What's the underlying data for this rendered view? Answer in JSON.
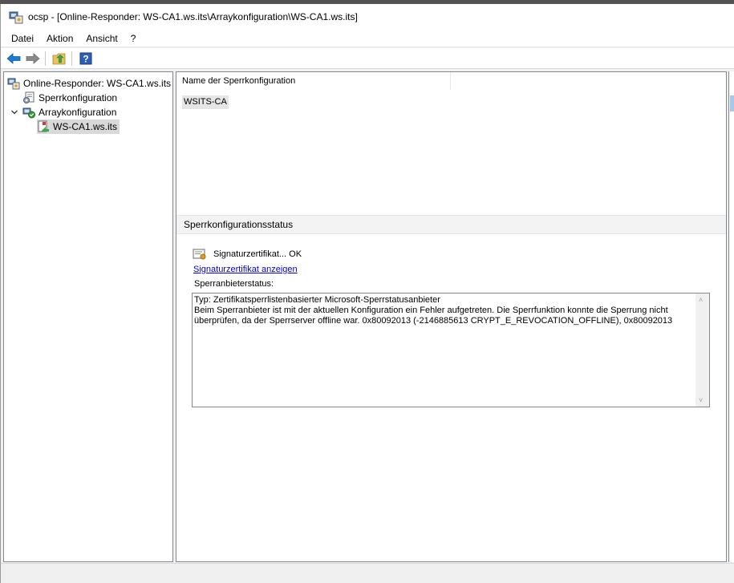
{
  "window": {
    "title": "ocsp - [Online-Responder: WS-CA1.ws.its\\Arraykonfiguration\\WS-CA1.ws.its]"
  },
  "menu": {
    "items": [
      "Datei",
      "Aktion",
      "Ansicht",
      "?"
    ]
  },
  "toolbar": {
    "buttons": [
      "back-arrow-icon",
      "forward-arrow-icon",
      "up-folder-icon",
      "help-icon"
    ]
  },
  "tree": {
    "root": "Online-Responder: WS-CA1.ws.its",
    "items": [
      {
        "label": "Sperrkonfiguration"
      },
      {
        "label": "Arraykonfiguration"
      },
      {
        "label": "WS-CA1.ws.its"
      }
    ]
  },
  "list": {
    "column_header": "Name der Sperrkonfiguration",
    "rows": [
      "WSITS-CA"
    ]
  },
  "status": {
    "section_title": "Sperrkonfigurationsstatus",
    "cert_status": "Signaturzertifikat... OK",
    "cert_link": "Signaturzertifikat anzeigen",
    "provider_label": "Sperranbieterstatus:",
    "provider_text": "Typ: Zertifikatsperrlistenbasierter Microsoft-Sperrstatusanbieter\nBeim Sperranbieter ist mit der aktuellen Konfiguration ein Fehler aufgetreten. Die Sperrfunktion konnte die Sperrung nicht überprüfen, da der Sperrserver offline war. 0x80092013 (-2146885613 CRYPT_E_REVOCATION_OFFLINE), 0x80092013"
  },
  "colors": {
    "link": "#0000ee",
    "selection": "#d9d9d9",
    "toolbar_arrow": "#1e7bd4"
  }
}
